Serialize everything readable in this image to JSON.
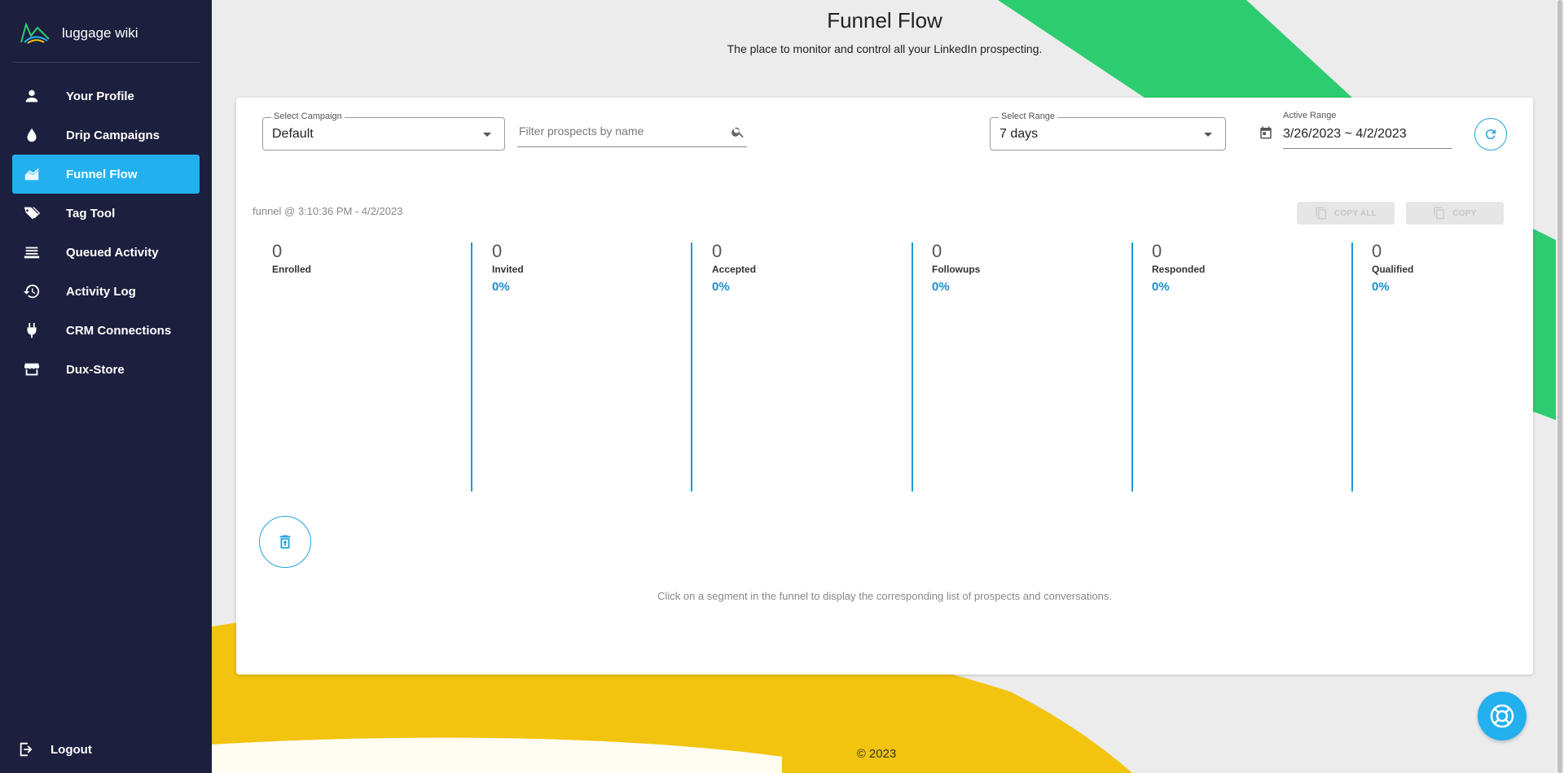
{
  "app": {
    "brand_name": "luggage wiki"
  },
  "sidebar": {
    "items": [
      {
        "label": "Your Profile",
        "icon": "person-icon",
        "active": false
      },
      {
        "label": "Drip Campaigns",
        "icon": "drop-icon",
        "active": false
      },
      {
        "label": "Funnel Flow",
        "icon": "chart-area-icon",
        "active": true
      },
      {
        "label": "Tag Tool",
        "icon": "tags-icon",
        "active": false
      },
      {
        "label": "Queued Activity",
        "icon": "queue-icon",
        "active": false
      },
      {
        "label": "Activity Log",
        "icon": "history-icon",
        "active": false
      },
      {
        "label": "CRM Connections",
        "icon": "plug-icon",
        "active": false
      },
      {
        "label": "Dux-Store",
        "icon": "store-icon",
        "active": false
      }
    ],
    "logout_label": "Logout"
  },
  "header": {
    "title": "Funnel Flow",
    "subtitle": "The place to monitor and control all your LinkedIn prospecting."
  },
  "filters": {
    "campaign": {
      "label": "Select Campaign",
      "value": "Default"
    },
    "search": {
      "placeholder": "Filter prospects by name"
    },
    "range": {
      "label": "Select Range",
      "value": "7 days"
    },
    "active_range": {
      "label": "Active Range",
      "value": "3/26/2023 ~ 4/2/2023"
    }
  },
  "funnel": {
    "timestamp": "funnel @ 3:10:36 PM - 4/2/2023",
    "copy_all_label": "COPY ALL",
    "copy_label": "COPY",
    "stages": [
      {
        "count": "0",
        "label": "Enrolled",
        "pct": ""
      },
      {
        "count": "0",
        "label": "Invited",
        "pct": "0%"
      },
      {
        "count": "0",
        "label": "Accepted",
        "pct": "0%"
      },
      {
        "count": "0",
        "label": "Followups",
        "pct": "0%"
      },
      {
        "count": "0",
        "label": "Responded",
        "pct": "0%"
      },
      {
        "count": "0",
        "label": "Qualified",
        "pct": "0%"
      }
    ],
    "hint": "Click on a segment in the funnel to display the corresponding list of prospects and conversations."
  },
  "footer": {
    "copyright": "© 2023"
  },
  "colors": {
    "sidebar_bg": "#1c1f3d",
    "accent": "#22b0ef",
    "green_shape": "#2ecc71",
    "yellow_shape": "#f2c40f"
  }
}
